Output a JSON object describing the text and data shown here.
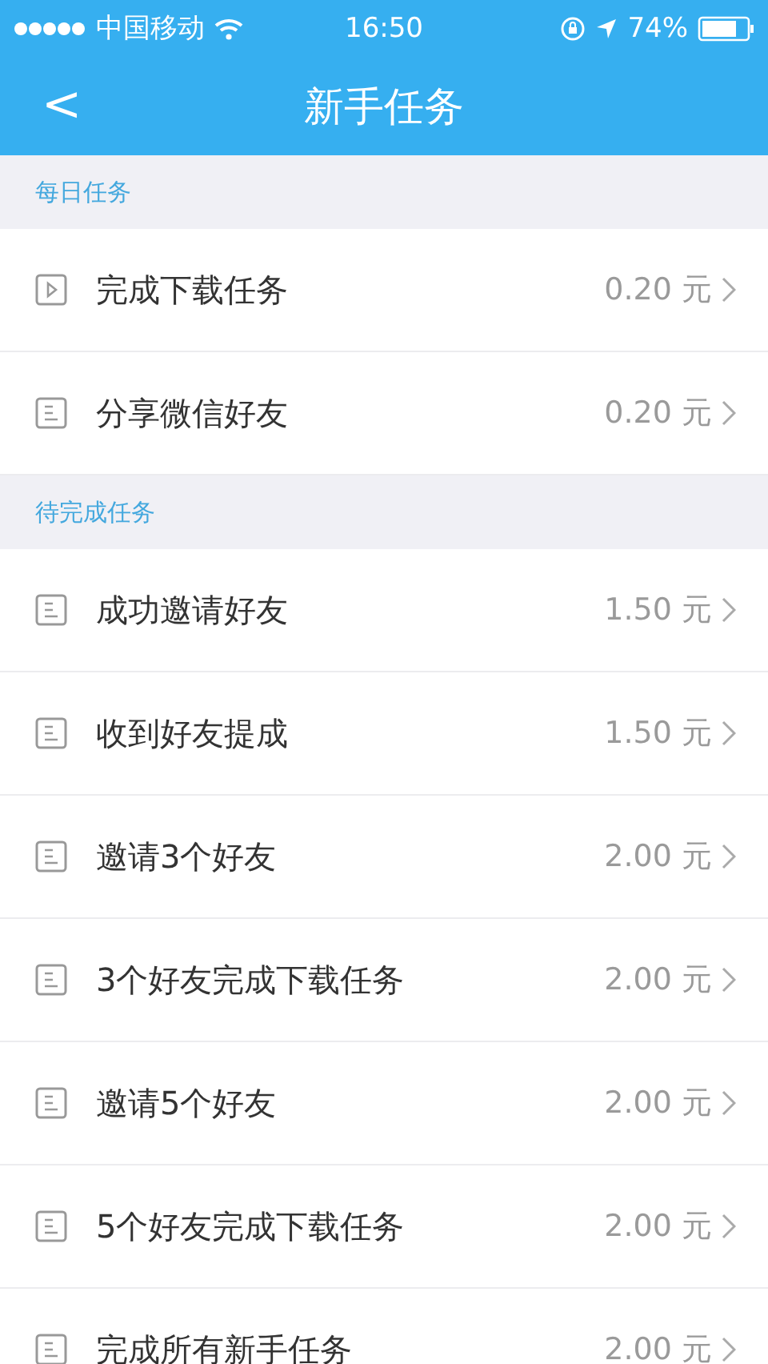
{
  "status_bar": {
    "carrier": "中国移动",
    "time": "16:50",
    "battery": "74%"
  },
  "nav": {
    "back": "<",
    "title": "新手任务"
  },
  "sections": [
    {
      "title": "每日任务",
      "items": [
        {
          "kind": "video",
          "label": "完成下载任务",
          "reward": "0.20 元"
        },
        {
          "kind": "doc",
          "label": "分享微信好友",
          "reward": "0.20 元"
        }
      ]
    },
    {
      "title": "待完成任务",
      "items": [
        {
          "kind": "doc",
          "label": "成功邀请好友",
          "reward": "1.50 元"
        },
        {
          "kind": "doc",
          "label": "收到好友提成",
          "reward": "1.50 元"
        },
        {
          "kind": "doc",
          "label": "邀请3个好友",
          "reward": "2.00 元"
        },
        {
          "kind": "doc",
          "label": "3个好友完成下载任务",
          "reward": "2.00 元"
        },
        {
          "kind": "doc",
          "label": "邀请5个好友",
          "reward": "2.00 元"
        },
        {
          "kind": "doc",
          "label": "5个好友完成下载任务",
          "reward": "2.00 元"
        },
        {
          "kind": "doc",
          "label": "完成所有新手任务",
          "reward": "2.00 元"
        }
      ]
    }
  ]
}
